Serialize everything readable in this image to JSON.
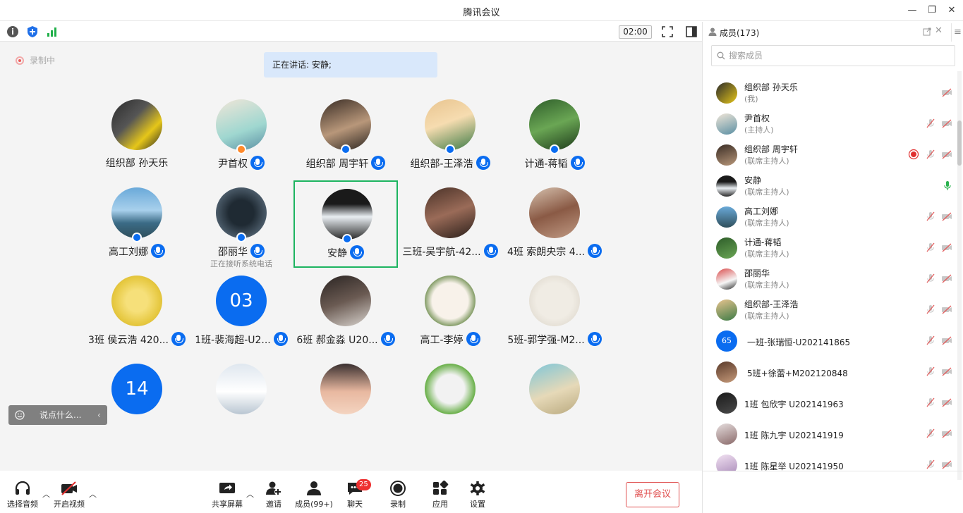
{
  "window": {
    "title": "腾讯会议"
  },
  "info_bar": {
    "timer": "02:00"
  },
  "recording": {
    "label": "录制中"
  },
  "speaking": {
    "text": "正在讲话: 安静;"
  },
  "grid": [
    {
      "name": "组织部 孙天乐",
      "mic": false,
      "badge": "",
      "sub": ""
    },
    {
      "name": "尹首权",
      "mic": true,
      "badge": "orange",
      "sub": ""
    },
    {
      "name": "组织部 周宇轩",
      "mic": true,
      "badge": "blue",
      "sub": ""
    },
    {
      "name": "组织部-王泽浩",
      "mic": true,
      "badge": "blue",
      "sub": ""
    },
    {
      "name": "计通-蒋韬",
      "mic": true,
      "badge": "blue",
      "sub": ""
    },
    {
      "name": "高工刘娜",
      "mic": true,
      "badge": "blue",
      "sub": ""
    },
    {
      "name": "邵丽华",
      "mic": true,
      "badge": "blue",
      "sub": "正在接听系统电话"
    },
    {
      "name": "安静",
      "mic": true,
      "badge": "blue",
      "sub": "",
      "active": true
    },
    {
      "name": "三班-吴宇航-42...",
      "mic": true,
      "badge": "",
      "sub": ""
    },
    {
      "name": "4班 索朗央宗 4...",
      "mic": true,
      "badge": "",
      "sub": ""
    },
    {
      "name": "3班 侯云浩 420...",
      "mic": true,
      "badge": "",
      "sub": ""
    },
    {
      "name": "1班-裴海超-U2...",
      "mic": true,
      "badge": "",
      "sub": "",
      "number": "03"
    },
    {
      "name": "6班 郝金淼 U20...",
      "mic": true,
      "badge": "",
      "sub": ""
    },
    {
      "name": "高工-李婷",
      "mic": true,
      "badge": "",
      "sub": ""
    },
    {
      "name": "5班-郭学强-M2...",
      "mic": true,
      "badge": "",
      "sub": ""
    },
    {
      "name": "",
      "mic": false,
      "badge": "",
      "sub": "",
      "number": "14"
    },
    {
      "name": "",
      "mic": false,
      "badge": "",
      "sub": ""
    },
    {
      "name": "",
      "mic": false,
      "badge": "",
      "sub": ""
    },
    {
      "name": "",
      "mic": false,
      "badge": "",
      "sub": ""
    },
    {
      "name": "",
      "mic": false,
      "badge": "",
      "sub": ""
    }
  ],
  "chat": {
    "placeholder": "说点什么..."
  },
  "toolbar": {
    "audio": "选择音频",
    "video": "开启视频",
    "share": "共享屏幕",
    "invite": "邀请",
    "members": "成员(99+)",
    "chat": "聊天",
    "chat_badge": "25",
    "record": "录制",
    "apps": "应用",
    "settings": "设置",
    "leave": "离开会议"
  },
  "sidebar": {
    "title": "成员(173)",
    "search_placeholder": "搜索成员",
    "members": [
      {
        "name": "组织部 孙天乐",
        "role": "(我)",
        "mic": "none",
        "rec": false
      },
      {
        "name": "尹首权",
        "role": "(主持人)",
        "mic": "muted",
        "rec": false
      },
      {
        "name": "组织部 周宇轩",
        "role": "(联席主持人)",
        "mic": "muted",
        "rec": true
      },
      {
        "name": "安静",
        "role": "(联席主持人)",
        "mic": "active",
        "rec": false
      },
      {
        "name": "高工刘娜",
        "role": "(联席主持人)",
        "mic": "muted",
        "rec": false
      },
      {
        "name": "计通-蒋韬",
        "role": "(联席主持人)",
        "mic": "muted",
        "rec": false
      },
      {
        "name": "邵丽华",
        "role": "(联席主持人)",
        "mic": "muted",
        "rec": false
      },
      {
        "name": "组织部-王泽浩",
        "role": "(联席主持人)",
        "mic": "muted",
        "rec": false
      },
      {
        "name": "一班-张瑞恒-U202141865",
        "role": "",
        "mic": "muted",
        "rec": false,
        "number": "65"
      },
      {
        "name": "5班+徐蕾+M202120848",
        "role": "",
        "mic": "muted",
        "rec": false
      },
      {
        "name": "1班 包欣宇 U202141963",
        "role": "",
        "mic": "muted",
        "rec": false
      },
      {
        "name": "1班 陈九宇 U202141919",
        "role": "",
        "mic": "muted",
        "rec": false
      },
      {
        "name": "1班 陈星举 U202141950",
        "role": "",
        "mic": "muted",
        "rec": false
      }
    ]
  }
}
